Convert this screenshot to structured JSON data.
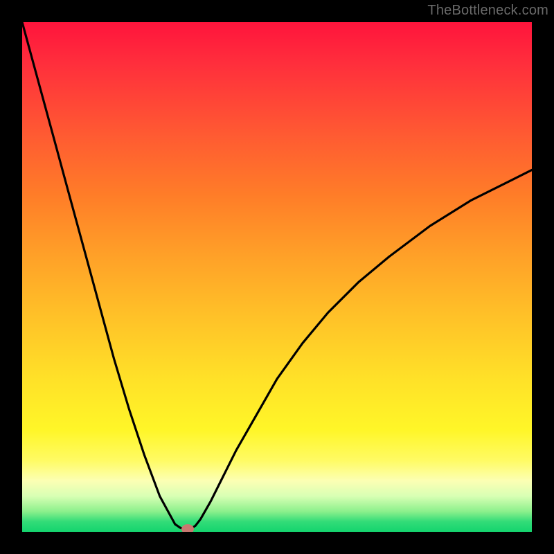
{
  "attribution": "TheBottleneck.com",
  "chart_data": {
    "type": "line",
    "title": "",
    "xlabel": "",
    "ylabel": "",
    "xlim": [
      0,
      100
    ],
    "ylim": [
      0,
      100
    ],
    "series": [
      {
        "name": "bottleneck-curve",
        "x": [
          0,
          3,
          6,
          9,
          12,
          15,
          18,
          21,
          24,
          27,
          30,
          31,
          32,
          33,
          34,
          35,
          37,
          39,
          42,
          46,
          50,
          55,
          60,
          66,
          72,
          80,
          88,
          96,
          100
        ],
        "values": [
          100,
          89,
          78,
          67,
          56,
          45,
          34,
          24,
          15,
          7,
          1.5,
          0.8,
          0.5,
          0.6,
          1.2,
          2.5,
          6,
          10,
          16,
          23,
          30,
          37,
          43,
          49,
          54,
          60,
          65,
          69,
          71
        ]
      }
    ],
    "marker": {
      "x": 32.5,
      "y": 0.5
    },
    "background": "rainbow-vertical-red-to-green"
  }
}
